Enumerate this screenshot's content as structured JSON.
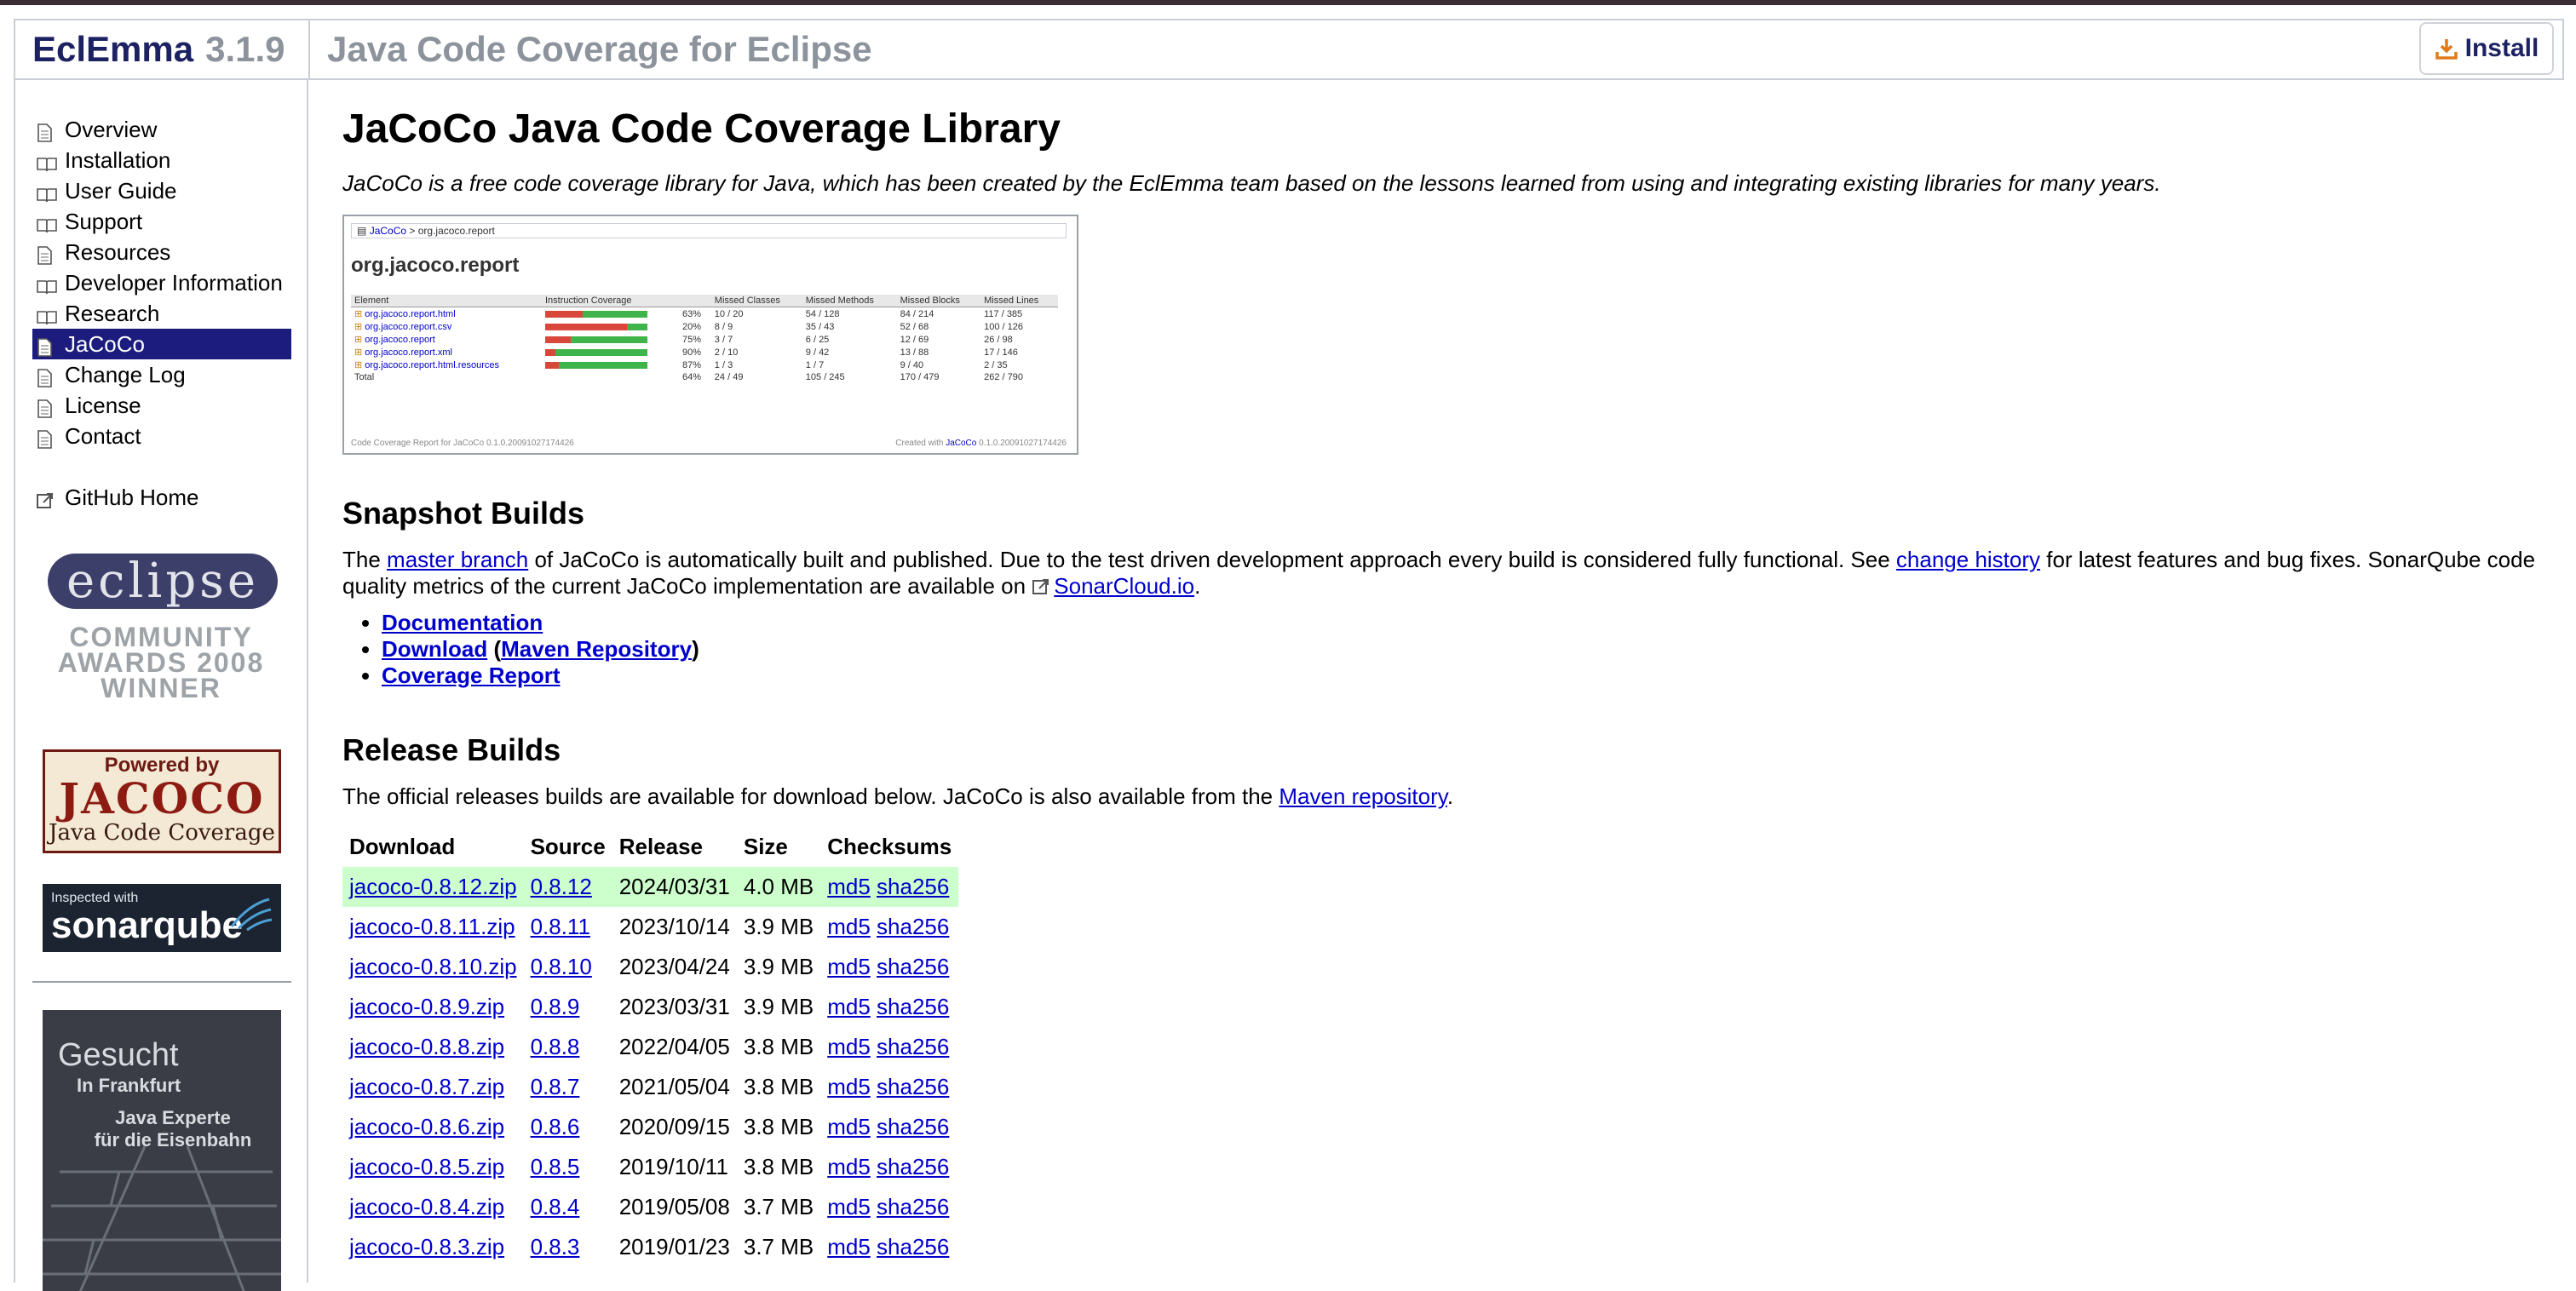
{
  "header": {
    "brand": "EclEmma",
    "version": "3.1.9",
    "subtitle": "Java Code Coverage for Eclipse",
    "install_label": "Install"
  },
  "sidebar": {
    "items": [
      {
        "label": "Overview",
        "icon": "page-icon"
      },
      {
        "label": "Installation",
        "icon": "book-icon"
      },
      {
        "label": "User Guide",
        "icon": "book-icon"
      },
      {
        "label": "Support",
        "icon": "book-icon"
      },
      {
        "label": "Resources",
        "icon": "page-icon"
      },
      {
        "label": "Developer Information",
        "icon": "book-icon"
      },
      {
        "label": "Research",
        "icon": "book-icon"
      },
      {
        "label": "JaCoCo",
        "icon": "page-icon",
        "active": true
      },
      {
        "label": "Change Log",
        "icon": "page-icon"
      },
      {
        "label": "License",
        "icon": "page-icon"
      },
      {
        "label": "Contact",
        "icon": "page-icon"
      }
    ],
    "github_label": "GitHub Home",
    "eclipse_award": {
      "word": "eclipse",
      "line1": "COMMUNITY",
      "line2": "AWARDS 2008",
      "line3": "WINNER"
    },
    "jacoco_badge": {
      "powered": "Powered by",
      "name": "JACOCO",
      "sub": "Java Code Coverage"
    },
    "sonar": {
      "inspected": "Inspected with",
      "name": "sonarqube"
    },
    "job_ad": {
      "line1": "Gesucht",
      "line2": "In Frankfurt",
      "line3": "Java Experte",
      "line4": "für die Eisenbahn"
    }
  },
  "main": {
    "title": "JaCoCo Java Code Coverage Library",
    "lead": "JaCoCo is a free code coverage library for Java, which has been created by the EclEmma team based on the lessons learned from using and integrating existing libraries for many years.",
    "preview": {
      "crumb_root": "JaCoCo",
      "crumb_sep": ">",
      "crumb_pkg": "org.jacoco.report",
      "title": "org.jacoco.report",
      "headers": [
        "Element",
        "Instruction Coverage",
        "",
        "Missed Classes",
        "Missed Methods",
        "Missed Blocks",
        "Missed Lines"
      ],
      "rows": [
        {
          "name": "org.jacoco.report.html",
          "cov": 0.63,
          "pct": "63%",
          "c": "10 / 20",
          "m": "54 / 128",
          "b": "84 / 214",
          "l": "117 / 385"
        },
        {
          "name": "org.jacoco.report.csv",
          "cov": 0.2,
          "pct": "20%",
          "c": "8 / 9",
          "m": "35 / 43",
          "b": "52 / 68",
          "l": "100 / 126"
        },
        {
          "name": "org.jacoco.report",
          "cov": 0.75,
          "pct": "75%",
          "c": "3 / 7",
          "m": "6 / 25",
          "b": "12 / 69",
          "l": "26 / 98"
        },
        {
          "name": "org.jacoco.report.xml",
          "cov": 0.9,
          "pct": "90%",
          "c": "2 / 10",
          "m": "9 / 42",
          "b": "13 / 88",
          "l": "17 / 146"
        },
        {
          "name": "org.jacoco.report.html.resources",
          "cov": 0.87,
          "pct": "87%",
          "c": "1 / 3",
          "m": "1 / 7",
          "b": "9 / 40",
          "l": "2 / 35"
        }
      ],
      "total": {
        "name": "Total",
        "pct": "64%",
        "c": "24 / 49",
        "m": "105 / 245",
        "b": "170 / 479",
        "l": "262 / 790"
      },
      "footer_left": "Code Coverage Report for JaCoCo 0.1.0.20091027174426",
      "footer_right_pre": "Created with",
      "footer_right_link": "JaCoCo",
      "footer_right_post": "0.1.0.20091027174426"
    },
    "snapshot": {
      "heading": "Snapshot Builds",
      "p1": "The ",
      "link1": "master branch",
      "p2": " of JaCoCo is automatically built and published. Due to the test driven development approach every build is considered fully functional. See ",
      "link2": "change history",
      "p3": " for latest features and bug fixes. SonarQube code quality metrics of the current JaCoCo implementation are available on ",
      "link3": "SonarCloud.io",
      "p4": ".",
      "bullets": {
        "doc": "Documentation",
        "download": "Download",
        "open": " (",
        "maven": "Maven Repository",
        "close": ")",
        "coverage": "Coverage Report"
      }
    },
    "release": {
      "heading": "Release Builds",
      "p1": "The official releases builds are available for download below. JaCoCo is also available from the ",
      "link": "Maven repository",
      "p2": ".",
      "columns": [
        "Download",
        "Source",
        "Release",
        "Size",
        "Checksums"
      ],
      "rows": [
        {
          "file": "jacoco-0.8.12.zip",
          "source": "0.8.12",
          "date": "2024/03/31",
          "size": "4.0 MB",
          "md5": "md5",
          "sha": "sha256",
          "highlight": true
        },
        {
          "file": "jacoco-0.8.11.zip",
          "source": "0.8.11",
          "date": "2023/10/14",
          "size": "3.9 MB",
          "md5": "md5",
          "sha": "sha256"
        },
        {
          "file": "jacoco-0.8.10.zip",
          "source": "0.8.10",
          "date": "2023/04/24",
          "size": "3.9 MB",
          "md5": "md5",
          "sha": "sha256"
        },
        {
          "file": "jacoco-0.8.9.zip",
          "source": "0.8.9",
          "date": "2023/03/31",
          "size": "3.9 MB",
          "md5": "md5",
          "sha": "sha256"
        },
        {
          "file": "jacoco-0.8.8.zip",
          "source": "0.8.8",
          "date": "2022/04/05",
          "size": "3.8 MB",
          "md5": "md5",
          "sha": "sha256"
        },
        {
          "file": "jacoco-0.8.7.zip",
          "source": "0.8.7",
          "date": "2021/05/04",
          "size": "3.8 MB",
          "md5": "md5",
          "sha": "sha256"
        },
        {
          "file": "jacoco-0.8.6.zip",
          "source": "0.8.6",
          "date": "2020/09/15",
          "size": "3.8 MB",
          "md5": "md5",
          "sha": "sha256"
        },
        {
          "file": "jacoco-0.8.5.zip",
          "source": "0.8.5",
          "date": "2019/10/11",
          "size": "3.8 MB",
          "md5": "md5",
          "sha": "sha256"
        },
        {
          "file": "jacoco-0.8.4.zip",
          "source": "0.8.4",
          "date": "2019/05/08",
          "size": "3.7 MB",
          "md5": "md5",
          "sha": "sha256"
        },
        {
          "file": "jacoco-0.8.3.zip",
          "source": "0.8.3",
          "date": "2019/01/23",
          "size": "3.7 MB",
          "md5": "md5",
          "sha": "sha256"
        }
      ]
    }
  },
  "colors": {
    "brand": "#1c2161",
    "muted": "#8c939c",
    "active_nav": "#1b1c7e",
    "link": "#0000cc",
    "highlight_row": "#ccffcc",
    "install_icon": "#e07b1a"
  }
}
